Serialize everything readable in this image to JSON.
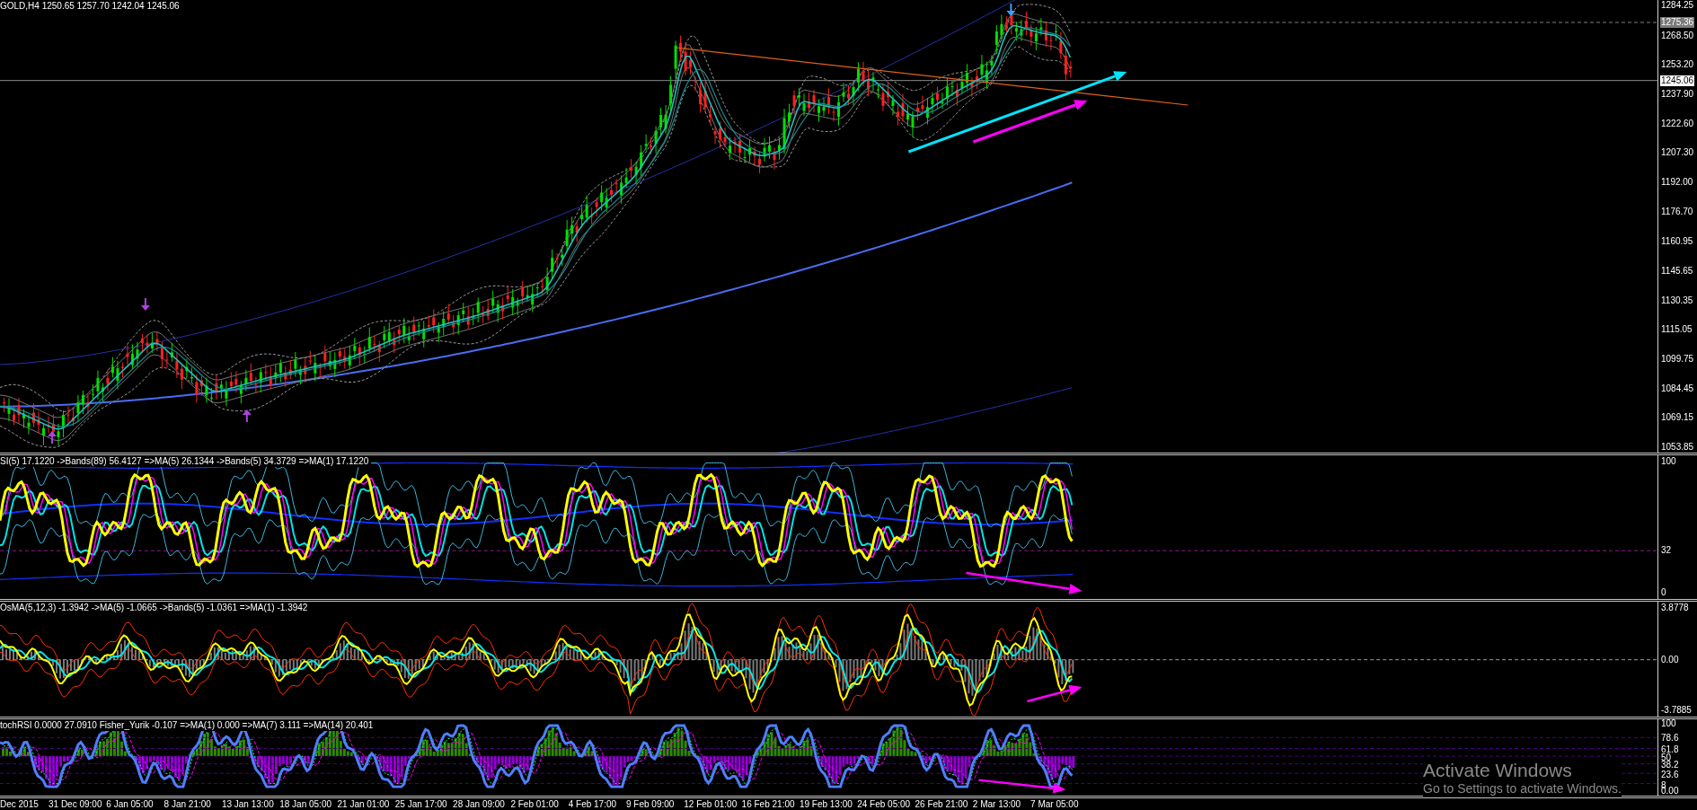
{
  "chart": {
    "title": "GOLD,H4  1250.65 1257.70 1242.04 1245.06",
    "price_axis": [
      {
        "label": "1284.25",
        "kind": "tick"
      },
      {
        "label": "1275.36",
        "kind": "marker"
      },
      {
        "label": "1268.50",
        "kind": "tick"
      },
      {
        "label": "1253.20",
        "kind": "tick"
      },
      {
        "label": "1245.06",
        "kind": "current"
      },
      {
        "label": "1237.90",
        "kind": "tick"
      },
      {
        "label": "1222.60",
        "kind": "tick"
      },
      {
        "label": "1207.30",
        "kind": "tick"
      },
      {
        "label": "1192.00",
        "kind": "tick"
      },
      {
        "label": "1176.70",
        "kind": "tick"
      },
      {
        "label": "1160.95",
        "kind": "tick"
      },
      {
        "label": "1145.65",
        "kind": "tick"
      },
      {
        "label": "1130.35",
        "kind": "tick"
      },
      {
        "label": "1115.05",
        "kind": "tick"
      },
      {
        "label": "1099.75",
        "kind": "tick"
      },
      {
        "label": "1084.45",
        "kind": "tick"
      },
      {
        "label": "1069.15",
        "kind": "tick"
      },
      {
        "label": "1053.85",
        "kind": "tick"
      }
    ]
  },
  "panes": [
    {
      "kind": "rsi",
      "label": "SI(5) 17.1220  ->Bands(89) 56.4127  =>MA(5) 26.1344  ->Bands(5) 34.3729  =>MA(1) 17.1220",
      "axis": [
        "100",
        "32",
        "0"
      ]
    },
    {
      "kind": "osma",
      "label": "OsMA(5,12,3) -1.3942  ->MA(5) -1.0665  ->Bands(5) -1.0361  =>MA(1) -1.3942",
      "axis": [
        "3.8778",
        "0.00",
        "-3.7885"
      ]
    },
    {
      "kind": "stoch",
      "label": "tochRSI 0.0000 27.0910  Fisher_Yurik -0.107  =>MA(1) 0.000  =>MA(7) 3.111  =>MA(14) 20.401",
      "axis": [
        "100",
        "78.6",
        "61.8",
        "50",
        "38.2",
        "23.6",
        "8",
        "0.00"
      ]
    }
  ],
  "time_axis": [
    "Dec 2015",
    "31 Dec 09:00",
    "6 Jan 05:00",
    "8 Jan 21:00",
    "13 Jan 13:00",
    "18 Jan 05:00",
    "21 Jan 01:00",
    "25 Jan 17:00",
    "28 Jan 09:00",
    "2 Feb 01:00",
    "4 Feb 17:00",
    "9 Feb 09:00",
    "12 Feb 01:00",
    "16 Feb 21:00",
    "19 Feb 13:00",
    "24 Feb 05:00",
    "26 Feb 21:00",
    "2 Mar 13:00",
    "7 Mar 05:00"
  ],
  "system_notice": {
    "title": "Activate Windows",
    "subtitle": "Go to Settings to activate Windows."
  }
}
